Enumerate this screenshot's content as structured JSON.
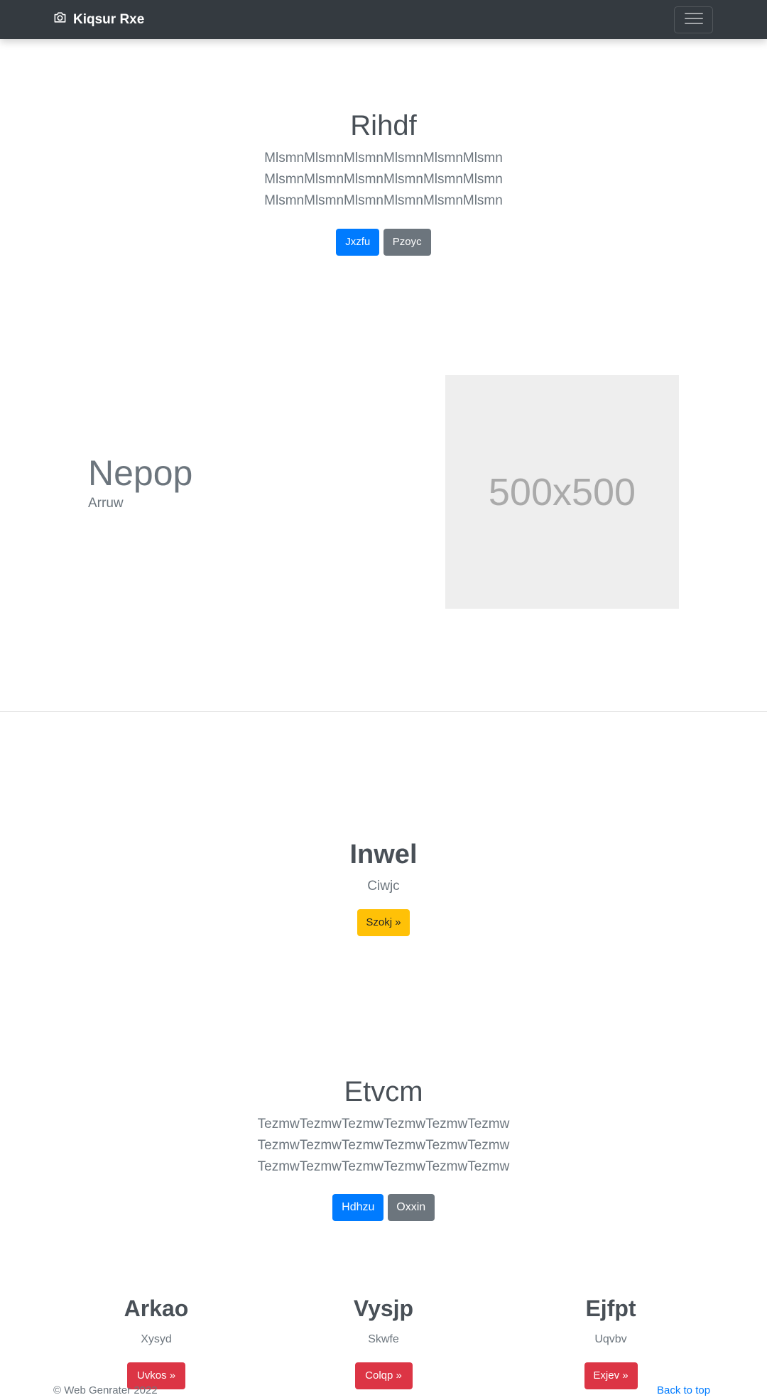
{
  "navbar": {
    "brand": "Kiqsur Rxe",
    "brand_icon": "camera-icon",
    "toggler_icon": "hamburger-icon"
  },
  "hero": {
    "title": "Rihdf",
    "lines": [
      "MlsmnMlsmnMlsmnMlsmnMlsmnMlsmn",
      "MlsmnMlsmnMlsmnMlsmnMlsmnMlsmn",
      "MlsmnMlsmnMlsmnMlsmnMlsmnMlsmn"
    ],
    "primary_label": "Jxzfu",
    "secondary_label": "Pzoyc"
  },
  "feature": {
    "title": "Nepop",
    "subtitle": "Arruw",
    "image_label": "500x500"
  },
  "cta": {
    "title": "Inwel",
    "text": "Ciwjc",
    "button_label": "Szokj »"
  },
  "section2": {
    "title": "Etvcm",
    "lines": [
      "TezmwTezmwTezmwTezmwTezmwTezmw",
      "TezmwTezmwTezmwTezmwTezmwTezmw",
      "TezmwTezmwTezmwTezmwTezmwTezmw"
    ],
    "primary_label": "Hdhzu",
    "secondary_label": "Oxxin"
  },
  "columns": [
    {
      "title": "Arkao",
      "text": "Xysyd",
      "button_label": "Uvkos »"
    },
    {
      "title": "Vysjp",
      "text": "Skwfe",
      "button_label": "Colqp »"
    },
    {
      "title": "Ejfpt",
      "text": "Uqvbv",
      "button_label": "Exjev »"
    }
  ],
  "footer": {
    "copyright": "© Web Genrater 2022",
    "back_to_top": "Back to top"
  },
  "colors": {
    "navbar": "#343a40",
    "primary": "#007bff",
    "secondary": "#6c757d",
    "warning": "#ffc107",
    "danger": "#dc3545"
  }
}
